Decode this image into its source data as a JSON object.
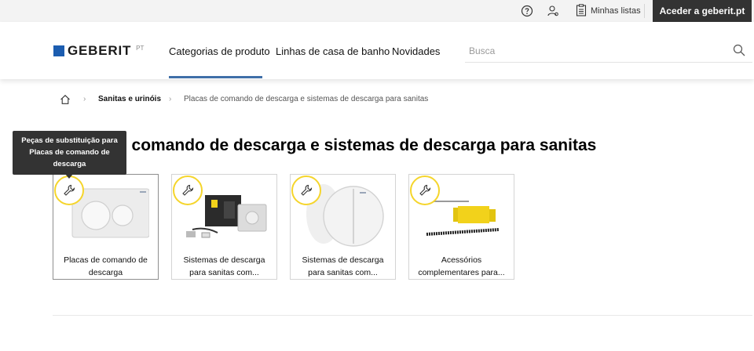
{
  "utility_bar": {
    "lists_label": "Minhas listas",
    "cta_label": "Aceder a geberit.pt",
    "icons": [
      "help-icon",
      "user-icon",
      "list-icon"
    ]
  },
  "header": {
    "logo_text": "GEBERIT",
    "country": "PT",
    "nav": [
      "Categorias de produto",
      "Linhas de casa de banho",
      "Novidades"
    ],
    "search_placeholder": "Busca",
    "colors": {
      "brand": "#1c5db0",
      "nav_active": "#3f6fa8",
      "badge": "#f5d52c",
      "dark": "#333333"
    }
  },
  "breadcrumb": {
    "items": [
      "Sanitas e urinóis",
      "Placas de comando de descarga e sistemas de descarga para sanitas"
    ]
  },
  "page_title": "e comando de descarga e sistemas de descarga para sanitas",
  "tooltip": {
    "lines": [
      "Peças de substituição para",
      "Placas de comando de",
      "descarga"
    ]
  },
  "cards": [
    {
      "line1": "Placas de comando de",
      "line2": "descarga"
    },
    {
      "line1": "Sistemas de descarga",
      "line2": "para sanitas com..."
    },
    {
      "line1": "Sistemas de descarga",
      "line2": "para sanitas com..."
    },
    {
      "line1": "Acessórios",
      "line2": "complementares para..."
    }
  ]
}
